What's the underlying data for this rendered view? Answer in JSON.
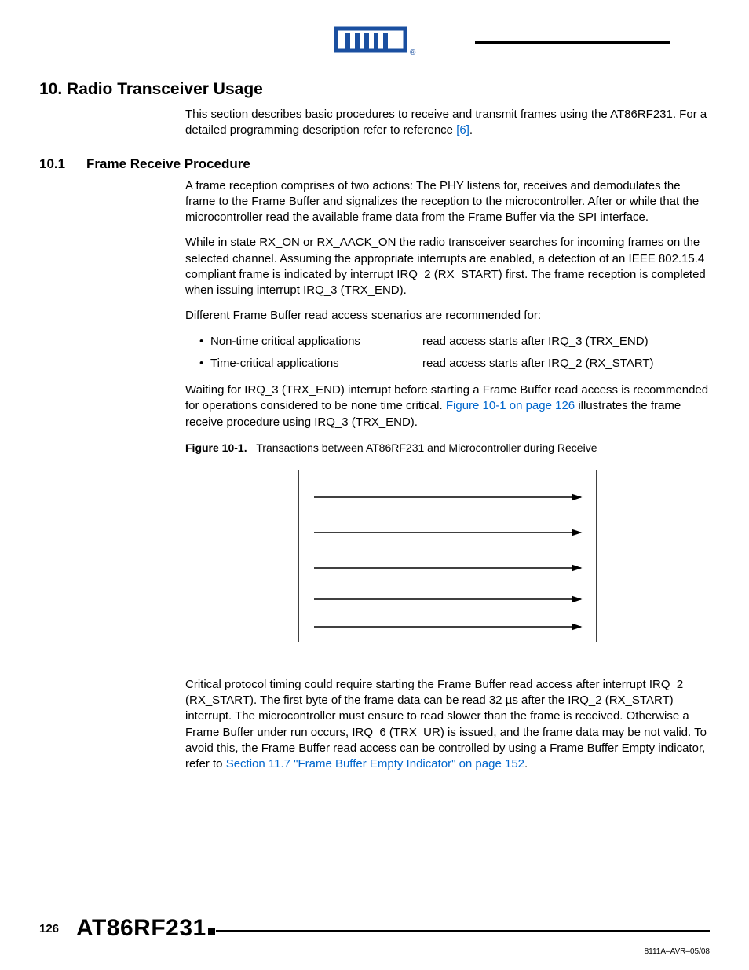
{
  "header": {
    "logo_text": "ATMEL"
  },
  "section": {
    "number": "10.",
    "title": "Radio Transceiver Usage",
    "intro": "This section describes basic procedures to receive and transmit frames using the AT86RF231. For a detailed programming description refer to reference ",
    "intro_ref": "[6]",
    "intro_end": "."
  },
  "subsection": {
    "number": "10.1",
    "title": "Frame Receive Procedure",
    "p1": "A frame reception comprises of two actions: The PHY listens for, receives and demodulates the frame to the Frame Buffer and signalizes the reception to the microcontroller. After or while that the microcontroller read the available frame data from the Frame Buffer via the SPI interface.",
    "p2": "While in state RX_ON or RX_AACK_ON the radio transceiver searches for incoming frames on the selected channel. Assuming the appropriate interrupts are enabled, a detection of an IEEE 802.15.4 compliant frame is indicated by interrupt IRQ_2 (RX_START) first. The frame reception is completed when issuing interrupt IRQ_3 (TRX_END).",
    "p3": "Different Frame Buffer read access scenarios are recommended for:",
    "bullets": [
      {
        "left": "Non-time critical applications",
        "right": "read access starts after IRQ_3 (TRX_END)"
      },
      {
        "left": "Time-critical applications",
        "right": "read access starts after IRQ_2 (RX_START)"
      }
    ],
    "p4a": "Waiting for IRQ_3 (TRX_END) interrupt before starting a Frame Buffer read access is recommended for operations considered to be none time critical. ",
    "p4link": "Figure 10-1 on page 126",
    "p4b": " illustrates the frame receive procedure using IRQ_3 (TRX_END).",
    "fig_label": "Figure 10-1.",
    "fig_caption": "Transactions between AT86RF231 and Microcontroller during Receive",
    "p5a": "Critical protocol timing could require starting the Frame Buffer read access after interrupt IRQ_2 (RX_START). The first byte of the frame data can be read 32 µs after the IRQ_2 (RX_START) interrupt. The microcontroller must ensure to read slower than the frame is received. Otherwise a Frame Buffer under run occurs, IRQ_6 (TRX_UR) is issued, and the frame data may be not valid. To avoid this, the Frame Buffer read access can be controlled by using a Frame Buffer Empty indicator, refer to ",
    "p5link": "Section 11.7 \"Frame Buffer Empty Indicator\" on page 152",
    "p5b": "."
  },
  "footer": {
    "page": "126",
    "product": "AT86RF231",
    "docid": "8111A–AVR–05/08"
  }
}
